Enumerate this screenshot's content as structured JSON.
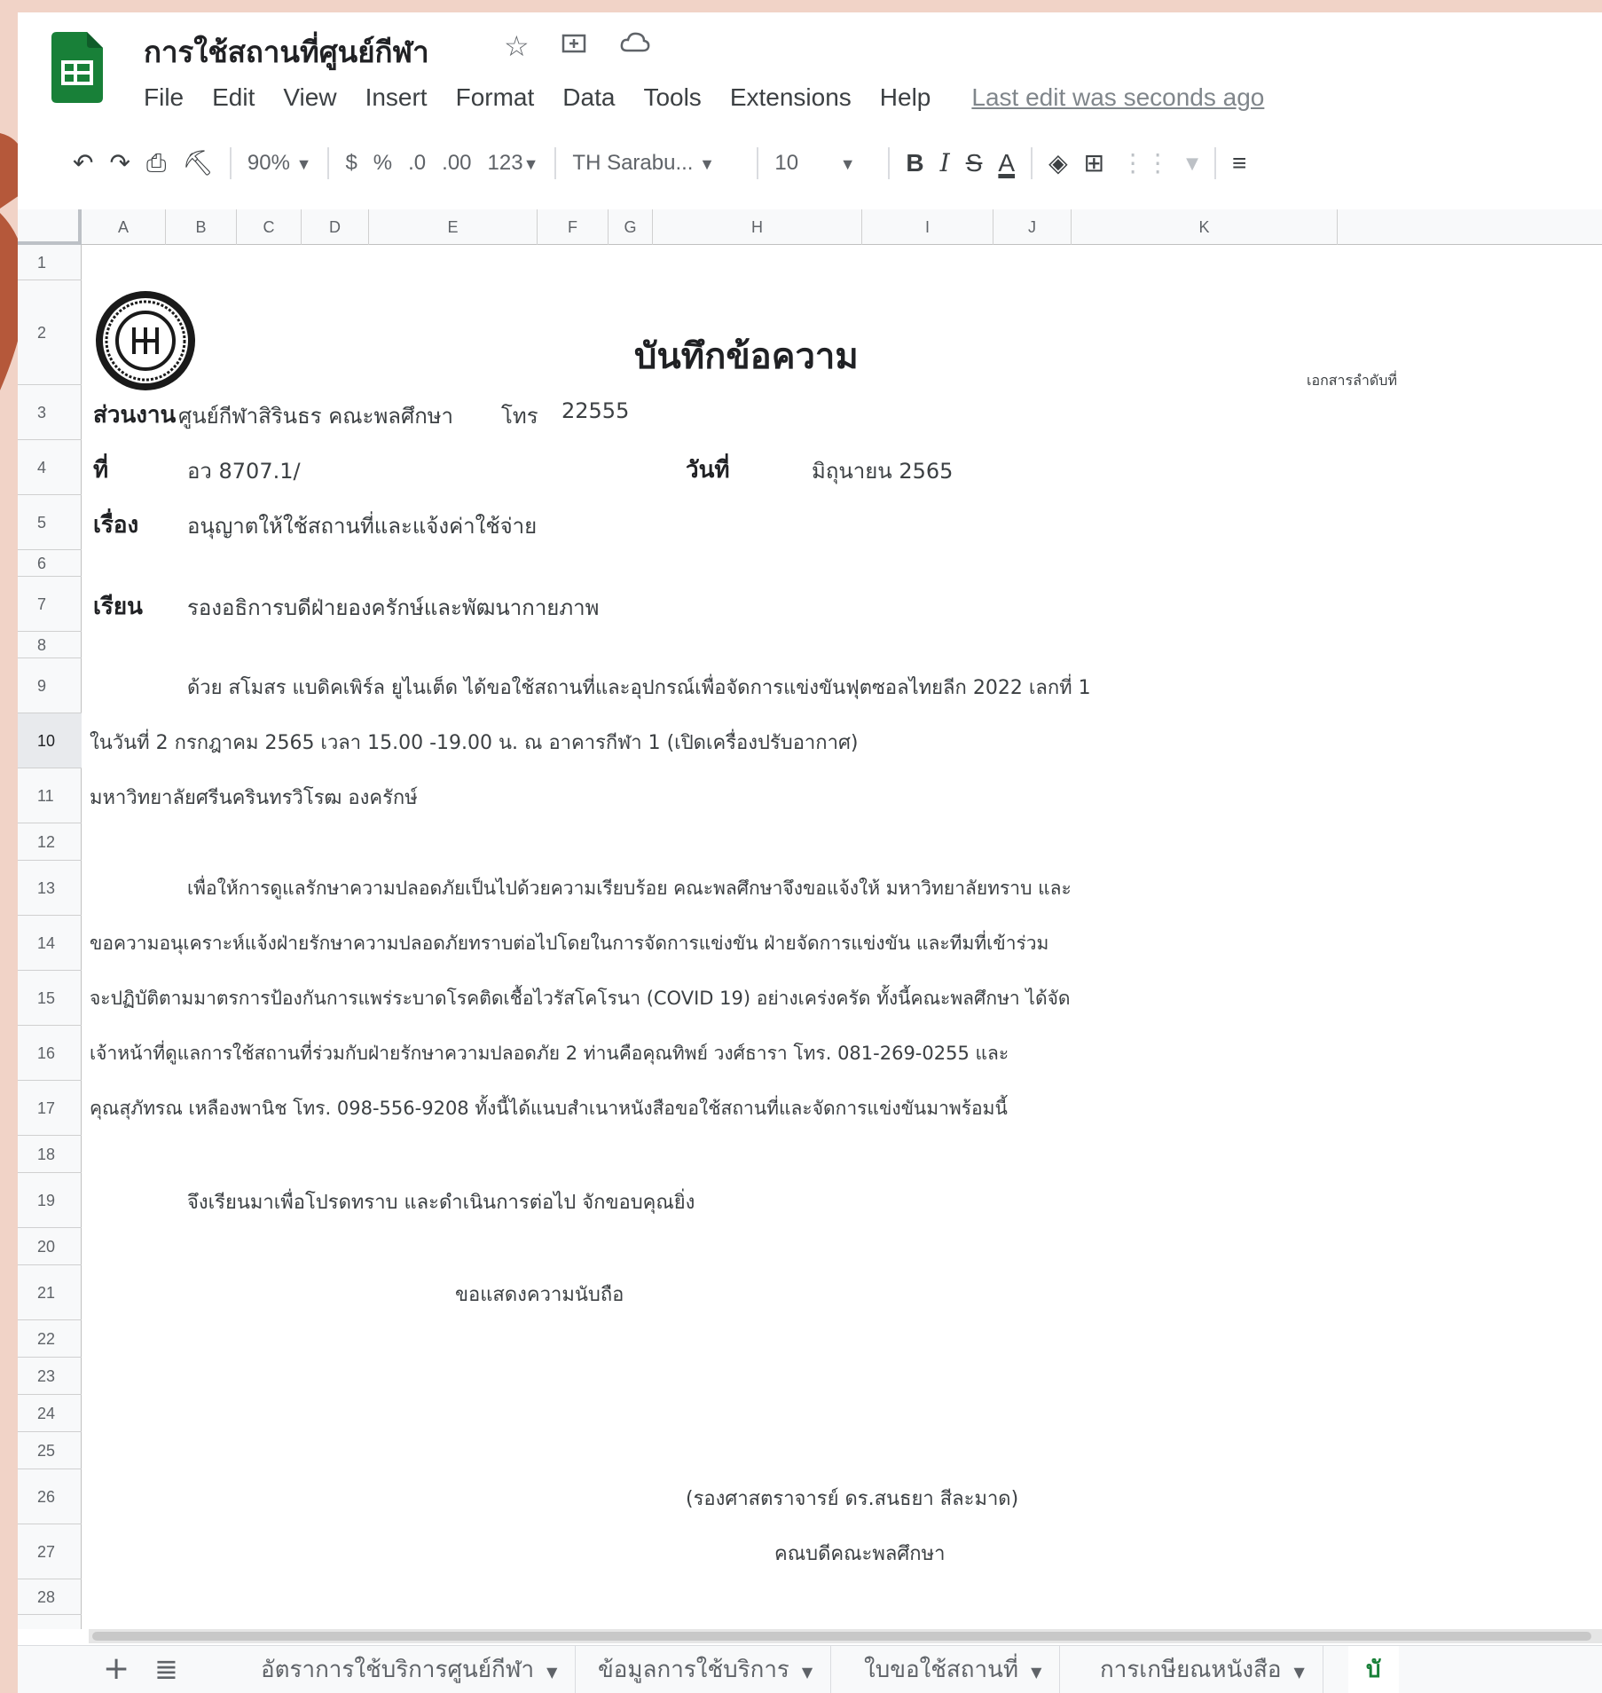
{
  "document": {
    "title": "การใช้สถานที่ศูนย์กีฬา",
    "menu": [
      "File",
      "Edit",
      "View",
      "Insert",
      "Format",
      "Data",
      "Tools",
      "Extensions",
      "Help"
    ],
    "last_edit": "Last edit was seconds ago"
  },
  "toolbar": {
    "zoom": "90%",
    "currency": "$",
    "percent": "%",
    "decrease_decimal": ".0",
    "increase_decimal": ".00",
    "more_formats": "123",
    "font": "TH Sarabu...",
    "font_size": "10",
    "bold": "B",
    "italic": "I",
    "strikethrough": "S",
    "text_color": "A"
  },
  "grid": {
    "columns": [
      "A",
      "B",
      "C",
      "D",
      "E",
      "F",
      "G",
      "H",
      "I",
      "J",
      "K"
    ],
    "rows": [
      "1",
      "2",
      "3",
      "4",
      "5",
      "6",
      "7",
      "8",
      "9",
      "10",
      "11",
      "12",
      "13",
      "14",
      "15",
      "16",
      "17",
      "18",
      "19",
      "20",
      "21",
      "22",
      "23",
      "24",
      "25",
      "26",
      "27",
      "28"
    ],
    "selected_row": "10"
  },
  "memo": {
    "heading": "บันทึกข้อความ",
    "doc_no_label": "เอกสารลำดับที่",
    "dept_label": "ส่วนงาน",
    "dept_value": "ศูนย์กีฬาสิรินธร คณะพลศึกษา",
    "tel_label": "โทร",
    "tel_value": "22555",
    "no_label": "ที่",
    "no_value": "อว 8707.1/",
    "date_label": "วันที่",
    "date_value": "มิถุนายน 2565",
    "subject_label": "เรื่อง",
    "subject_value": "อนุญาตให้ใช้สถานที่และแจ้งค่าใช้จ่าย",
    "to_label": "เรียน",
    "to_value": "รองอธิการบดีฝ่ายองครักษ์และพัฒนากายภาพ",
    "p1_line1": "ด้วย สโมสร แบดิคเพิร์ล ยูไนเต็ด ได้ขอใช้สถานที่และอุปกรณ์เพื่อจัดการแข่งขันฟุตซอลไทยลีก 2022 เลกที่ 1",
    "p1_line2": "ในวันที่  2 กรกฎาคม 2565   เวลา  15.00 -19.00 น. ณ อาคารกีฬา 1 (เปิดเครื่องปรับอากาศ)",
    "p1_line3": "มหาวิทยาลัยศรีนครินทรวิโรฒ องครักษ์",
    "p2_line1": "เพื่อให้การดูแลรักษาความปลอดภัยเป็นไปด้วยความเรียบร้อย คณะพลศึกษาจึงขอแจ้งให้ มหาวิทยาลัยทราบ และ",
    "p2_line2": "ขอความอนุเคราะห์แจ้งฝ่ายรักษาความปลอดภัยทราบต่อไปโดยในการจัดการแข่งขัน ฝ่ายจัดการแข่งขัน และทีมที่เข้าร่วม",
    "p2_line3": "จะปฏิบัติตามมาตรการป้องกันการแพร่ระบาดโรคติดเชื้อไวรัสโคโรนา (COVID 19) อย่างเคร่งครัด ทั้งนี้คณะพลศึกษา ได้จัด",
    "p2_line4": "เจ้าหน้าที่ดูแลการใช้สถานที่ร่วมกับฝ่ายรักษาความปลอดภัย 2 ท่านคือคุณทิพย์  วงศ์ธารา โทร. 081-269-0255 และ",
    "p2_line5": "คุณสุภัทรณ  เหลืองพานิช โทร. 098-556-9208 ทั้งนี้ได้แนบสำเนาหนังสือขอใช้สถานที่และจัดการแข่งขันมาพร้อมนี้",
    "closing": "จึงเรียนมาเพื่อโปรดทราบ และดำเนินการต่อไป จักขอบคุณยิ่ง",
    "regards": "ขอแสดงความนับถือ",
    "signer": "(รองศาสตราจารย์ ดร.สนธยา สีละมาด)",
    "position": "คณบดีคณะพลศึกษา"
  },
  "sheet_tabs": [
    "อัตราการใช้บริการศูนย์กีฬา",
    "ข้อมูลการใช้บริการ",
    "ใบขอใช้สถานที่",
    "การเกษียณหนังสือ",
    "บั"
  ],
  "colors": {
    "sheets_green": "#188038",
    "background": "#f1d3c7",
    "accent_brown": "#b5583a"
  }
}
